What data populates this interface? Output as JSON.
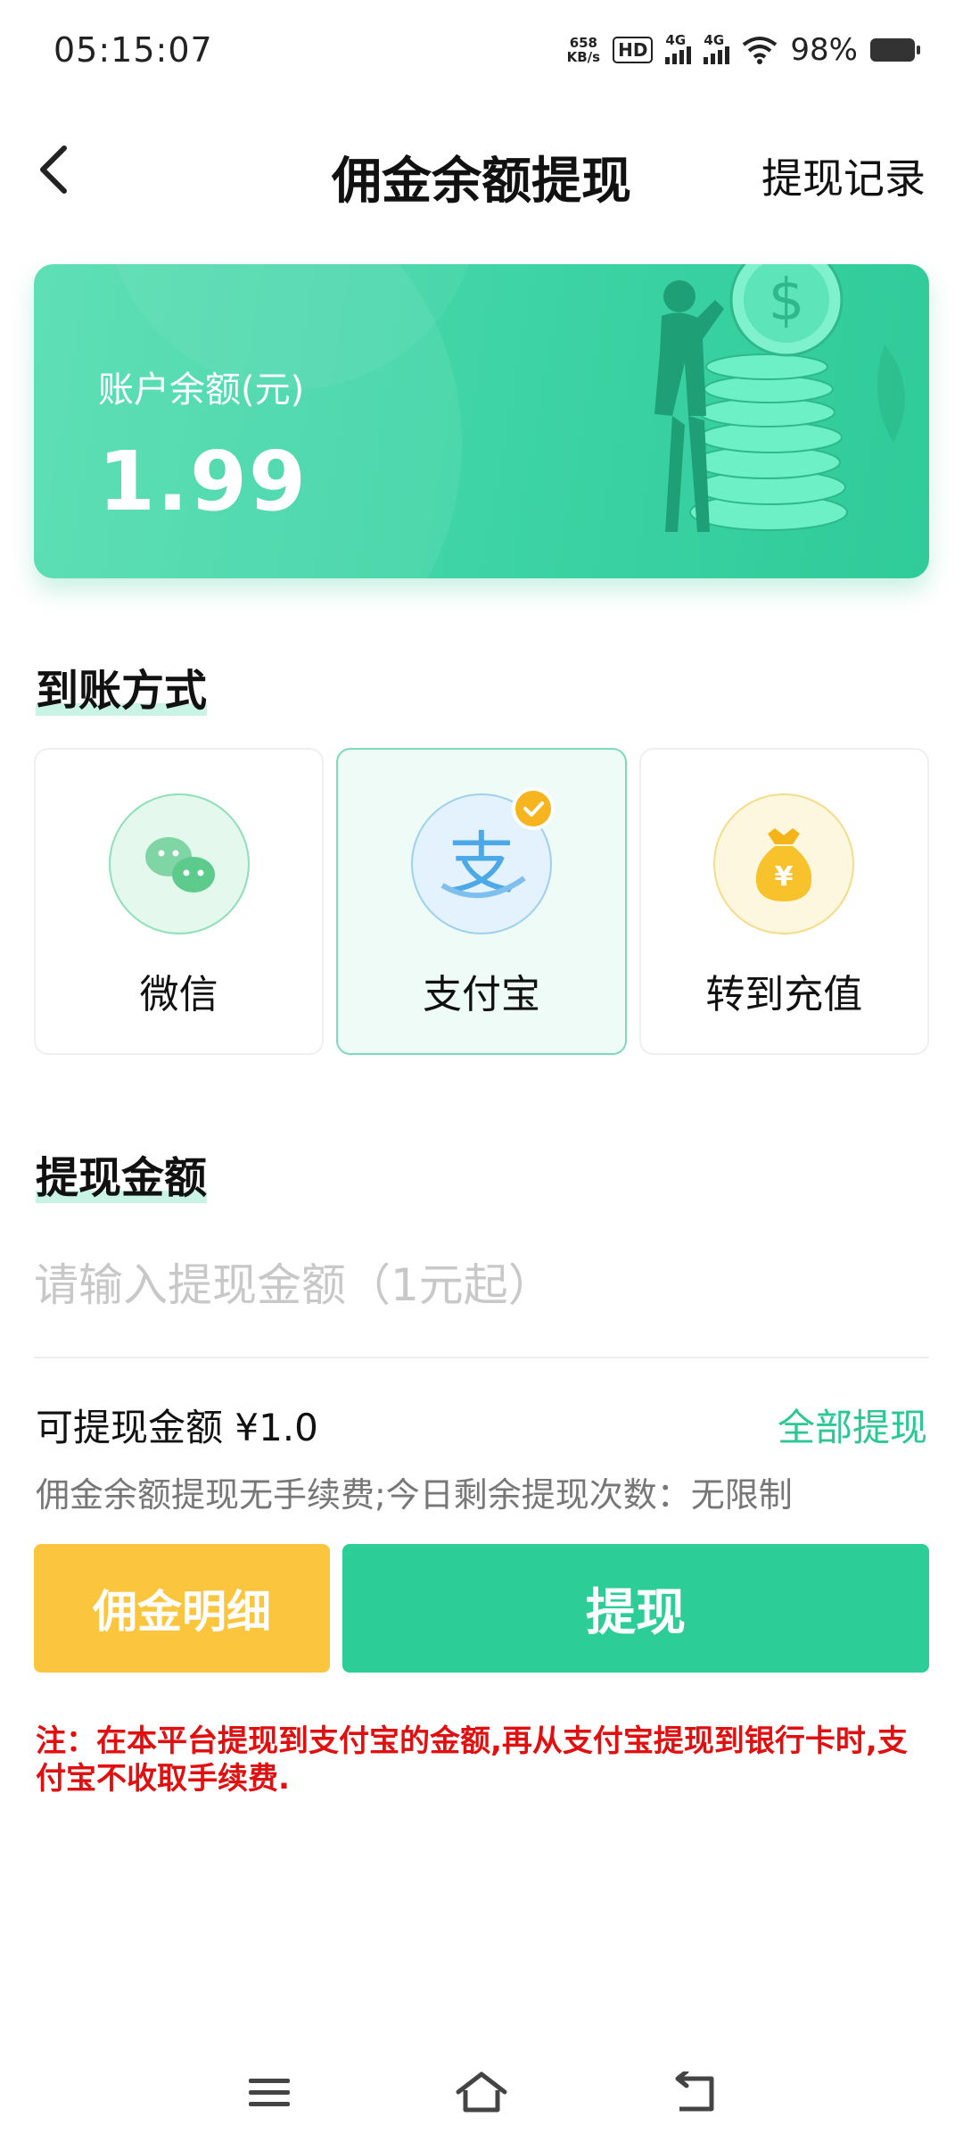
{
  "status_bar": {
    "time": "05:15:07",
    "net_speed_value": "658",
    "net_speed_unit": "KB/s",
    "hd": "HD",
    "signal1": "4G",
    "signal2": "4G",
    "battery": "98%"
  },
  "header": {
    "title": "佣金余额提现",
    "right_link": "提现记录"
  },
  "balance": {
    "label": "账户余额(元)",
    "value": "1.99"
  },
  "methods_section": {
    "title": "到账方式",
    "items": [
      {
        "label": "微信",
        "icon": "wechat-icon",
        "selected": false
      },
      {
        "label": "支付宝",
        "icon": "alipay-icon",
        "selected": true
      },
      {
        "label": "转到充值",
        "icon": "money-bag-icon",
        "selected": false
      }
    ]
  },
  "amount_section": {
    "title": "提现金额",
    "placeholder": "请输入提现金额（1元起）",
    "value": ""
  },
  "available": {
    "text": "可提现金额 ¥1.0",
    "withdraw_all": "全部提现",
    "fee_info": "佣金余额提现无手续费;今日剩余提现次数：无限制"
  },
  "buttons": {
    "detail": "佣金明细",
    "withdraw": "提现"
  },
  "note": "注：在本平台提现到支付宝的金额,再从支付宝提现到银行卡时,支付宝不收取手续费.",
  "colors": {
    "accent": "#2ccd96",
    "detail_button": "#fbc53d",
    "note": "#e01010"
  }
}
